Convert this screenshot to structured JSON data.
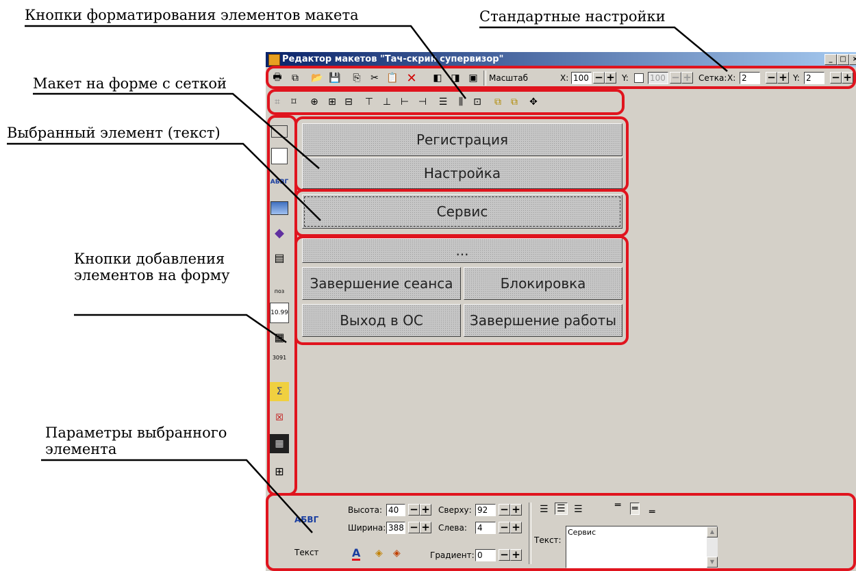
{
  "callouts": {
    "format_buttons": "Кнопки форматирования элементов макета",
    "standard_settings": "Стандартные настройки",
    "layout_grid": "Макет на форме с сеткой",
    "selected_element": "Выбранный элемент (текст)",
    "add_buttons": "Кнопки добавления элементов на форму",
    "params": "Параметры выбранного элемента"
  },
  "window": {
    "title": "Редактор макетов \"Тач-скрин супервизор\"",
    "controls": [
      "_",
      "□",
      "×"
    ]
  },
  "toolbar1": {
    "scale_label": "Масштаб",
    "x_label": "X:",
    "scale_x": "100",
    "y_label": "Y:",
    "scale_y": "100",
    "grid_label": "Сетка:",
    "grid_x_label": "X:",
    "grid_x": "2",
    "grid_y_label": "Y:",
    "grid_y": "2"
  },
  "form_buttons": {
    "registration": "Регистрация",
    "settings": "Настройка",
    "service": "Сервис",
    "more": "...",
    "end_session": "Завершение сеанса",
    "lock": "Блокировка",
    "exit_os": "Выход в ОС",
    "shutdown": "Завершение работы"
  },
  "left_toolbar": {
    "text_tool": "АБВГ",
    "number_tool": "10.99",
    "pos_tool": "поз",
    "info_tool": "3091"
  },
  "params": {
    "preview_text": "АБВГ",
    "element_type": "Текст",
    "height_label": "Высота:",
    "height": "40",
    "width_label": "Ширина:",
    "width": "388",
    "top_label": "Сверху:",
    "top": "92",
    "left_label": "Слева:",
    "left": "4",
    "gradient_label": "Градиент:",
    "gradient": "0",
    "text_label": "Текст:",
    "text_value": "Сервис"
  },
  "colors": {
    "highlight": "#e0141e",
    "titlebar_start": "#0a246a",
    "titlebar_end": "#a6caf0",
    "window_bg": "#d4d0c8"
  }
}
